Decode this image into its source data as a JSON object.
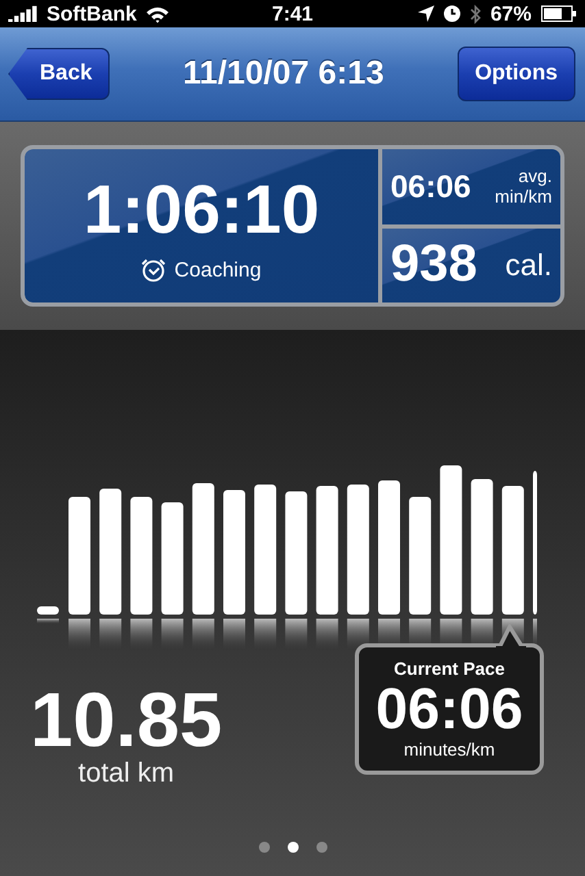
{
  "status_bar": {
    "carrier": "SoftBank",
    "time": "7:41",
    "battery": "67%"
  },
  "nav": {
    "back": "Back",
    "title": "11/10/07 6:13",
    "options": "Options"
  },
  "stats": {
    "duration": "1:06:10",
    "coaching": "Coaching",
    "pace": "06:06",
    "pace_unit_top": "avg.",
    "pace_unit_bottom": "min/km",
    "calories": "938",
    "calories_unit": "cal."
  },
  "distance": {
    "value": "10.85",
    "unit": "total km"
  },
  "current_pace": {
    "label": "Current Pace",
    "value": "06:06",
    "unit": "minutes/km"
  },
  "pages": [
    {
      "selected": false
    },
    {
      "selected": true
    },
    {
      "selected": false
    }
  ]
}
